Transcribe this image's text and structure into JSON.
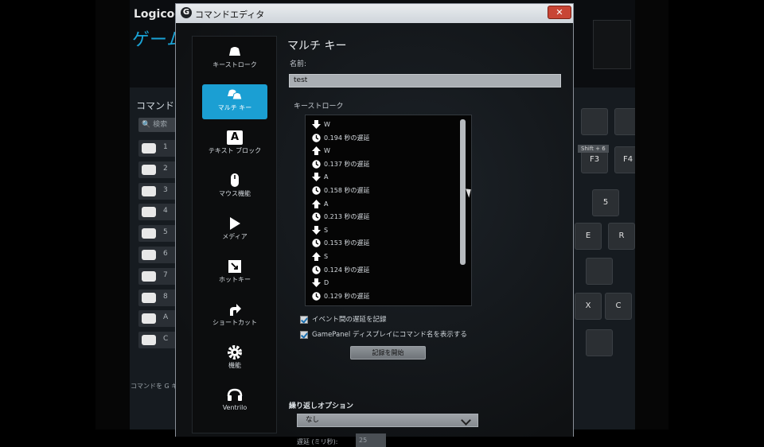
{
  "background_app": {
    "logo": "Logicoo",
    "heading": "ゲーム",
    "panel_title": "コマンド",
    "search_placeholder": "検索",
    "commands": [
      "1",
      "2",
      "3",
      "4",
      "5",
      "6",
      "7",
      "8",
      "A",
      "C"
    ],
    "footer_text": "コマンドを G キ",
    "tooltip": "Shift + 6",
    "keys": [
      "F3",
      "F4",
      "5",
      "E",
      "R",
      "X",
      "C"
    ]
  },
  "dialog": {
    "title": "コマンドエディタ",
    "title_logo": "G",
    "close_label": "✕",
    "sidebar": [
      {
        "label": "キーストローク",
        "icon": "keystroke-icon",
        "active": false
      },
      {
        "label": "マルチ キー",
        "icon": "multikey-icon",
        "active": true
      },
      {
        "label": "テキスト ブロック",
        "icon": "text-block-icon",
        "glyph": "A",
        "active": false
      },
      {
        "label": "マウス機能",
        "icon": "mouse-icon",
        "active": false
      },
      {
        "label": "メディア",
        "icon": "media-play-icon",
        "active": false
      },
      {
        "label": "ホットキー",
        "icon": "hotkey-icon",
        "active": false
      },
      {
        "label": "ショートカット",
        "icon": "shortcut-arrow-icon",
        "active": false
      },
      {
        "label": "機能",
        "icon": "gear-icon",
        "active": false
      },
      {
        "label": "Ventrilo",
        "icon": "ventrilo-icon",
        "active": false
      }
    ],
    "main": {
      "title": "マルチ キー",
      "name_label": "名前:",
      "name_value": "test",
      "keystroke_label": "キーストローク",
      "keystrokes": [
        {
          "type": "down",
          "text": "W"
        },
        {
          "type": "delay",
          "text": "0.194 秒の遅延"
        },
        {
          "type": "up",
          "text": "W"
        },
        {
          "type": "delay",
          "text": "0.137 秒の遅延"
        },
        {
          "type": "down",
          "text": "A"
        },
        {
          "type": "delay",
          "text": "0.158 秒の遅延"
        },
        {
          "type": "up",
          "text": "A"
        },
        {
          "type": "delay",
          "text": "0.213 秒の遅延"
        },
        {
          "type": "down",
          "text": "S"
        },
        {
          "type": "delay",
          "text": "0.153 秒の遅延"
        },
        {
          "type": "up",
          "text": "S"
        },
        {
          "type": "delay",
          "text": "0.124 秒の遅延"
        },
        {
          "type": "down",
          "text": "D"
        },
        {
          "type": "delay",
          "text": "0.129 秒の遅延"
        }
      ],
      "checkbox_record_delay": "イベント間の遅延を記録",
      "checkbox_gamepanel": "GamePanel ディスプレイにコマンド名を表示する",
      "record_button": "記録を開始",
      "repeat_label": "繰り返しオプション",
      "repeat_value": "なし",
      "delay_label": "遅延 (ミリ秒):",
      "delay_value": "25"
    }
  },
  "colors": {
    "accent": "#1b9fd3",
    "close": "#c84535",
    "heading": "#1aa3d6"
  }
}
